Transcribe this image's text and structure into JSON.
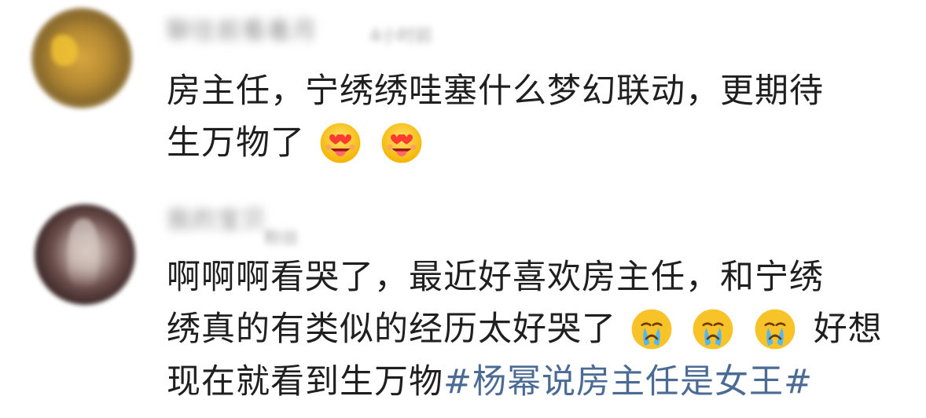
{
  "comments": [
    {
      "username": "聊往前看着月",
      "badge": "4小时前",
      "line1": "房主任，宁绣绣哇塞什么梦幻联动，更期待",
      "line2": "生万物了",
      "emojis": [
        "heart-eyes-icon",
        "heart-eyes-icon"
      ]
    },
    {
      "username": "我的宝贝",
      "badge": "粉丝",
      "line1": "啊啊啊看哭了，最近好喜欢房主任，和宁绣",
      "line2_a": "绣真的有类似的经历太好哭了",
      "line2_b": "好想",
      "line3": "现在就看到生万物",
      "hashtag": "#杨幂说房主任是女王#",
      "emojis": [
        "crying-face-icon",
        "crying-face-icon",
        "crying-face-icon"
      ]
    }
  ],
  "colors": {
    "text": "#1f1f1f",
    "hashtag": "#4b6b94",
    "muted": "#8a8a8a"
  }
}
